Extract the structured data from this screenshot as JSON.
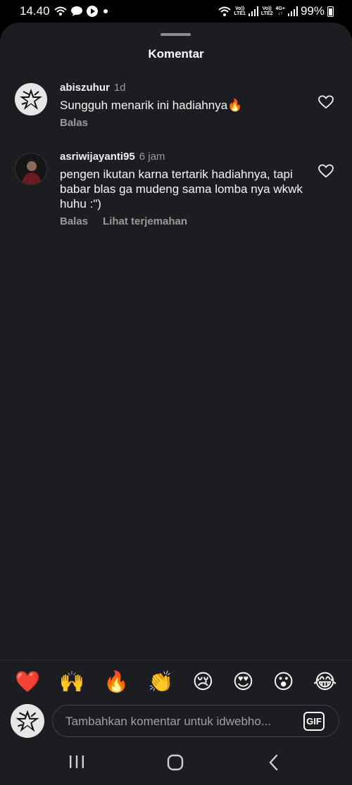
{
  "status_bar": {
    "time": "14.40",
    "net1_top": "Vo))",
    "net1_bottom": "LTE1",
    "net2_top": "Vo))",
    "net2_bottom": "LTE2",
    "net2_type": "4G+",
    "battery": "99%"
  },
  "sheet": {
    "title": "Komentar"
  },
  "comments": [
    {
      "user": "abiszuhur",
      "time": "1d",
      "text": "Sungguh menarik ini hadiahnya🔥",
      "actions": [
        "Balas"
      ]
    },
    {
      "user": "asriwijayanti95",
      "time": "6 jam",
      "text": "pengen ikutan karna tertarik hadiahnya, tapi babar blas ga mudeng sama lomba nya wkwk huhu :\")",
      "actions": [
        "Balas",
        "Lihat terjemahan"
      ]
    }
  ],
  "emoji_bar": [
    "❤️",
    "🙌",
    "🔥",
    "👏",
    "😢",
    "😍",
    "😮",
    "😂"
  ],
  "composer": {
    "placeholder": "Tambahkan komentar untuk idwebho...",
    "gif_label": "GIF"
  },
  "colors": {
    "background": "#1c1d20",
    "text": "#f5f5f5",
    "muted": "#9a9a9a"
  }
}
